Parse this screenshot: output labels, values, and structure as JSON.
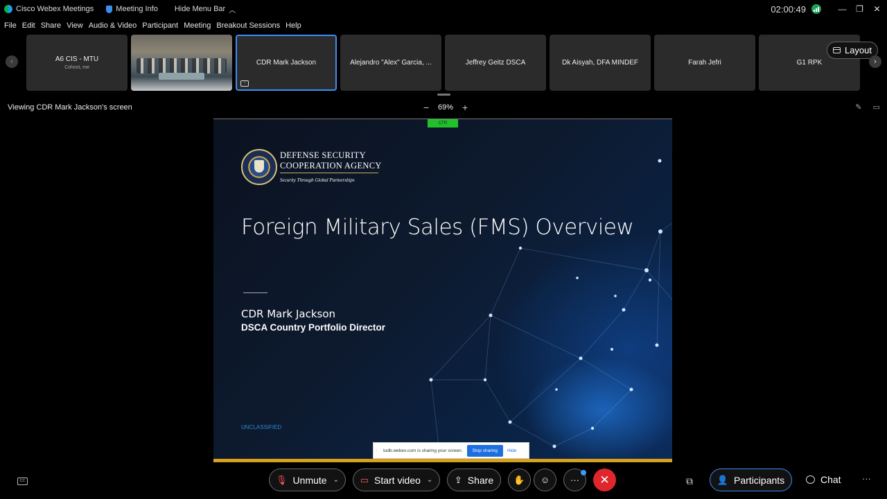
{
  "titlebar": {
    "app_name": "Cisco Webex Meetings",
    "meeting_info": "Meeting Info",
    "hide_menu": "Hide Menu Bar",
    "timer": "02:00:49"
  },
  "menu": [
    "File",
    "Edit",
    "Share",
    "View",
    "Audio & Video",
    "Participant",
    "Meeting",
    "Breakout Sessions",
    "Help"
  ],
  "participants": [
    {
      "name": "A6 CIS - MTU",
      "sub": "Cohost, me"
    },
    {
      "name": "",
      "sub": ""
    },
    {
      "name": "CDR Mark Jackson",
      "sub": ""
    },
    {
      "name": "Alejandro \"Alex\" Garcia, ...",
      "sub": ""
    },
    {
      "name": "Jeffrey Geitz DSCA",
      "sub": ""
    },
    {
      "name": "Dk Aisyah, DFA MINDEF",
      "sub": ""
    },
    {
      "name": "Farah Jefri",
      "sub": ""
    },
    {
      "name": "G1 RPK",
      "sub": ""
    }
  ],
  "layout_label": "Layout",
  "viewing_text": "Viewing CDR Mark Jackson's screen",
  "zoom": "69%",
  "slide": {
    "ctr_tag": "CTR",
    "agency_line1": "DEFENSE SECURITY",
    "agency_line2": "COOPERATION AGENCY",
    "tagline": "Security Through Global Partnerships",
    "title": "Foreign Military Sales (FMS) Overview",
    "presenter_name": "CDR Mark Jackson",
    "presenter_role": "DSCA Country Portfolio Director",
    "classification": "UNCLASSIFIED",
    "share_notice": "tudb.webex.com is sharing your screen.",
    "stop_sharing": "Stop sharing",
    "hide": "Hide"
  },
  "controls": {
    "unmute": "Unmute",
    "start_video": "Start video",
    "share": "Share",
    "participants": "Participants",
    "chat": "Chat"
  },
  "colors": {
    "accent": "#3e8ef7",
    "end_call": "#e0262d",
    "gold": "#d6a21e"
  }
}
